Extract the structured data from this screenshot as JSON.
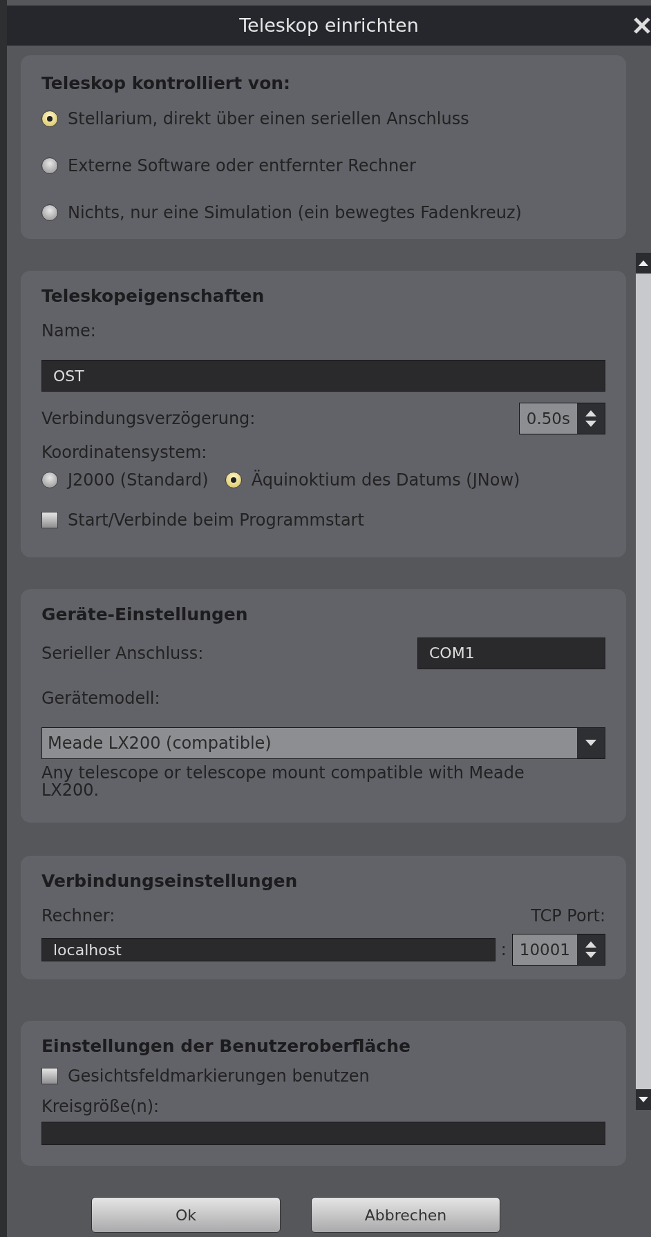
{
  "window": {
    "title": "Teleskop einrichten"
  },
  "control": {
    "title": "Teleskop kontrolliert von:",
    "options": [
      {
        "label": "Stellarium, direkt über einen seriellen Anschluss",
        "selected": true
      },
      {
        "label": "Externe Software oder entfernter Rechner",
        "selected": false
      },
      {
        "label": "Nichts, nur eine Simulation (ein bewegtes Fadenkreuz)",
        "selected": false
      }
    ]
  },
  "properties": {
    "title": "Teleskopeigenschaften",
    "name_label": "Name:",
    "name_value": "OST",
    "delay_label": "Verbindungsverzögerung:",
    "delay_value": "0.50s",
    "coords_label": "Koordinatensystem:",
    "coords_options": [
      {
        "label": "J2000 (Standard)",
        "selected": false
      },
      {
        "label": "Äquinoktium des Datums (JNow)",
        "selected": true
      }
    ],
    "autostart": {
      "label": "Start/Verbinde beim Programmstart",
      "checked": false
    }
  },
  "device": {
    "title": "Geräte-Einstellungen",
    "port_label": "Serieller Anschluss:",
    "port_value": "COM1",
    "model_label": "Gerätemodell:",
    "model_value": "Meade LX200 (compatible)",
    "description": "Any telescope or telescope mount compatible with Meade LX200."
  },
  "connection": {
    "title": "Verbindungseinstellungen",
    "host_label": "Rechner:",
    "host_value": "localhost",
    "port_label": "TCP Port:",
    "separator": ":",
    "port_value": "10001"
  },
  "ui": {
    "title": "Einstellungen der Benutzeroberfläche",
    "fov": {
      "label": "Gesichtsfeldmarkierungen benutzen",
      "checked": false
    },
    "circles_label": "Kreisgröße(n):"
  },
  "buttons": [
    {
      "label": "Ok"
    },
    {
      "label": "Abbrechen"
    }
  ]
}
